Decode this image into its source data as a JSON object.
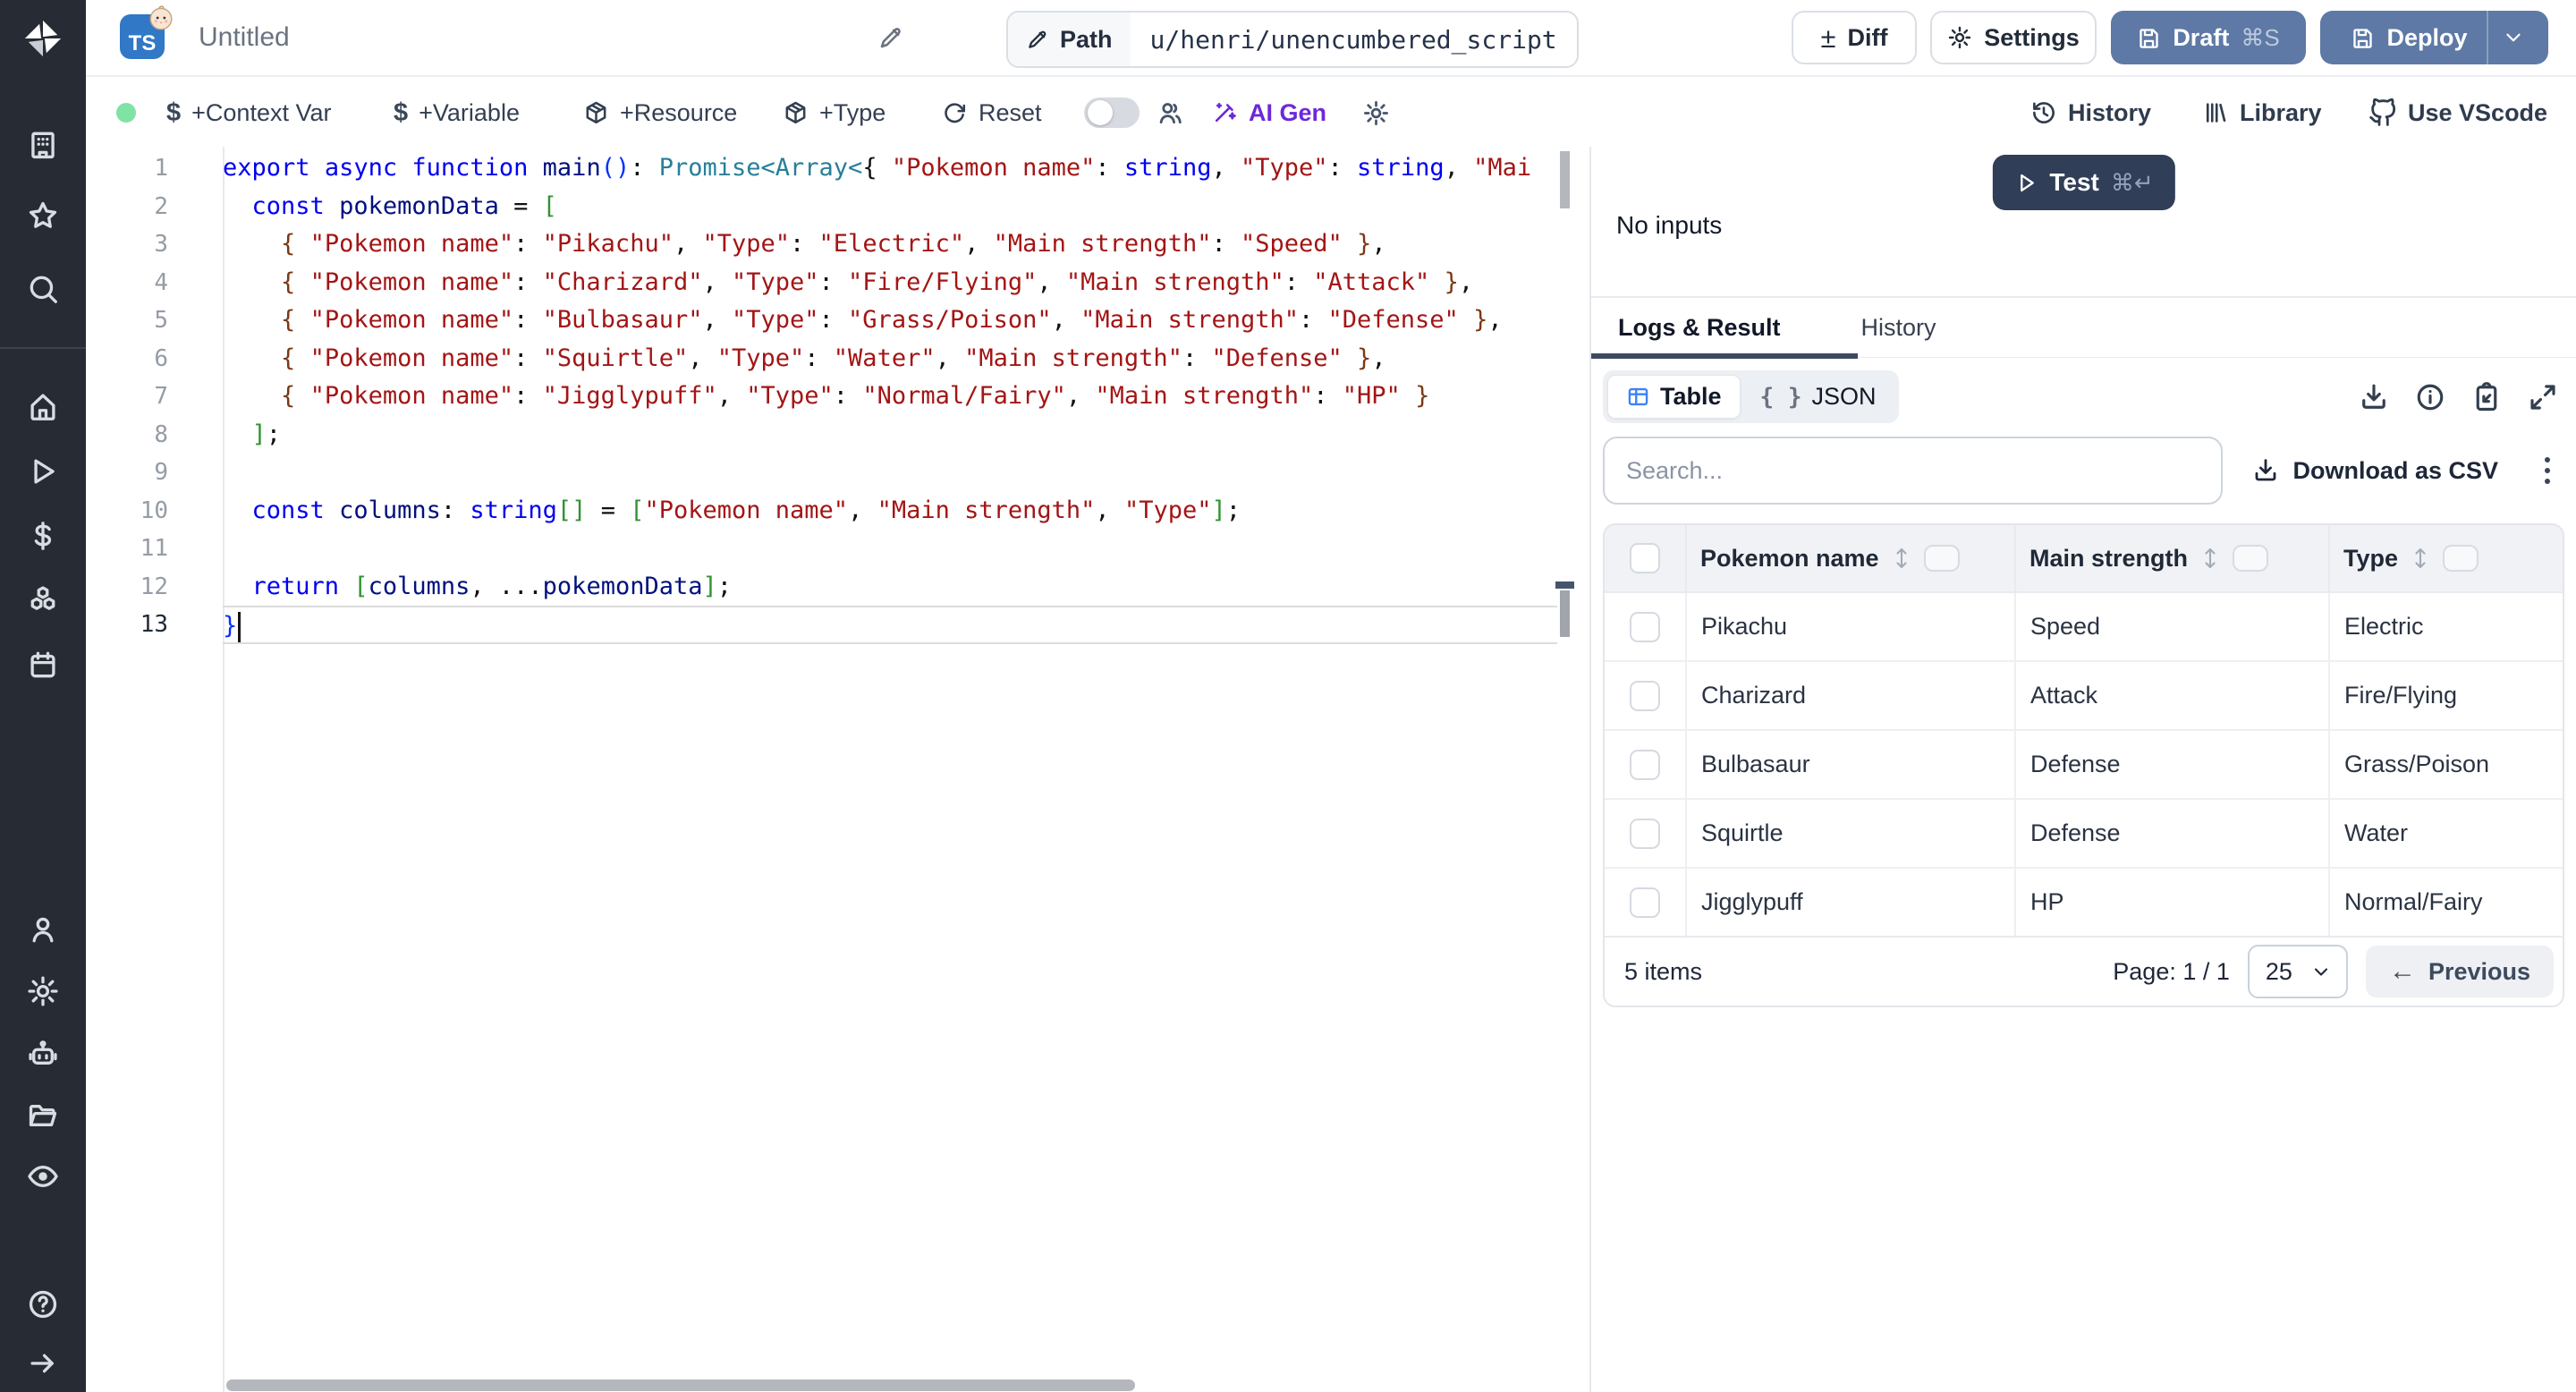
{
  "topbar": {
    "title": "Untitled",
    "path_label": "Path",
    "path_value": "u/henri/unencumbered_script",
    "diff": "Diff",
    "settings": "Settings",
    "draft": "Draft",
    "draft_kbd": "⌘S",
    "deploy": "Deploy",
    "language_badge": "TS"
  },
  "toolbar": {
    "context_var": "+Context Var",
    "variable": "+Variable",
    "resource": "+Resource",
    "type": "+Type",
    "reset": "Reset",
    "ai_gen": "AI Gen",
    "history": "History",
    "library": "Library",
    "vscode": "Use VScode"
  },
  "icons": {
    "dollar": "$",
    "diff_pm": "±",
    "braces": "{ }",
    "prev_arrow": "←"
  },
  "editor": {
    "lines": [
      {
        "num": 1,
        "tokens": [
          [
            "kw",
            "export"
          ],
          [
            "pu",
            " "
          ],
          [
            "kw",
            "async"
          ],
          [
            "pu",
            " "
          ],
          [
            "kw",
            "function"
          ],
          [
            "pu",
            " "
          ],
          [
            "id",
            "main"
          ],
          [
            "b1",
            "()"
          ],
          [
            "pu",
            ": "
          ],
          [
            "ty",
            "Promise<Array<"
          ],
          [
            "pu",
            "{ "
          ],
          [
            "st",
            "\"Pokemon name\""
          ],
          [
            "pu",
            ": "
          ],
          [
            "kw",
            "string"
          ],
          [
            "pu",
            ", "
          ],
          [
            "st",
            "\"Type\""
          ],
          [
            "pu",
            ": "
          ],
          [
            "kw",
            "string"
          ],
          [
            "pu",
            ", "
          ],
          [
            "st",
            "\"Mai"
          ]
        ]
      },
      {
        "num": 2,
        "tokens": [
          [
            "pu",
            "  "
          ],
          [
            "kw",
            "const"
          ],
          [
            "pu",
            " "
          ],
          [
            "id",
            "pokemonData"
          ],
          [
            "pu",
            " = "
          ],
          [
            "b2",
            "["
          ]
        ]
      },
      {
        "num": 3,
        "tokens": [
          [
            "pu",
            "    "
          ],
          [
            "b3",
            "{"
          ],
          [
            "pu",
            " "
          ],
          [
            "st",
            "\"Pokemon name\""
          ],
          [
            "pu",
            ": "
          ],
          [
            "st",
            "\"Pikachu\""
          ],
          [
            "pu",
            ", "
          ],
          [
            "st",
            "\"Type\""
          ],
          [
            "pu",
            ": "
          ],
          [
            "st",
            "\"Electric\""
          ],
          [
            "pu",
            ", "
          ],
          [
            "st",
            "\"Main strength\""
          ],
          [
            "pu",
            ": "
          ],
          [
            "st",
            "\"Speed\""
          ],
          [
            "pu",
            " "
          ],
          [
            "b3",
            "}"
          ],
          [
            "pu",
            ","
          ]
        ]
      },
      {
        "num": 4,
        "tokens": [
          [
            "pu",
            "    "
          ],
          [
            "b3",
            "{"
          ],
          [
            "pu",
            " "
          ],
          [
            "st",
            "\"Pokemon name\""
          ],
          [
            "pu",
            ": "
          ],
          [
            "st",
            "\"Charizard\""
          ],
          [
            "pu",
            ", "
          ],
          [
            "st",
            "\"Type\""
          ],
          [
            "pu",
            ": "
          ],
          [
            "st",
            "\"Fire/Flying\""
          ],
          [
            "pu",
            ", "
          ],
          [
            "st",
            "\"Main strength\""
          ],
          [
            "pu",
            ": "
          ],
          [
            "st",
            "\"Attack\""
          ],
          [
            "pu",
            " "
          ],
          [
            "b3",
            "}"
          ],
          [
            "pu",
            ","
          ]
        ]
      },
      {
        "num": 5,
        "tokens": [
          [
            "pu",
            "    "
          ],
          [
            "b3",
            "{"
          ],
          [
            "pu",
            " "
          ],
          [
            "st",
            "\"Pokemon name\""
          ],
          [
            "pu",
            ": "
          ],
          [
            "st",
            "\"Bulbasaur\""
          ],
          [
            "pu",
            ", "
          ],
          [
            "st",
            "\"Type\""
          ],
          [
            "pu",
            ": "
          ],
          [
            "st",
            "\"Grass/Poison\""
          ],
          [
            "pu",
            ", "
          ],
          [
            "st",
            "\"Main strength\""
          ],
          [
            "pu",
            ": "
          ],
          [
            "st",
            "\"Defense\""
          ],
          [
            "pu",
            " "
          ],
          [
            "b3",
            "}"
          ],
          [
            "pu",
            ","
          ]
        ]
      },
      {
        "num": 6,
        "tokens": [
          [
            "pu",
            "    "
          ],
          [
            "b3",
            "{"
          ],
          [
            "pu",
            " "
          ],
          [
            "st",
            "\"Pokemon name\""
          ],
          [
            "pu",
            ": "
          ],
          [
            "st",
            "\"Squirtle\""
          ],
          [
            "pu",
            ", "
          ],
          [
            "st",
            "\"Type\""
          ],
          [
            "pu",
            ": "
          ],
          [
            "st",
            "\"Water\""
          ],
          [
            "pu",
            ", "
          ],
          [
            "st",
            "\"Main strength\""
          ],
          [
            "pu",
            ": "
          ],
          [
            "st",
            "\"Defense\""
          ],
          [
            "pu",
            " "
          ],
          [
            "b3",
            "}"
          ],
          [
            "pu",
            ","
          ]
        ]
      },
      {
        "num": 7,
        "tokens": [
          [
            "pu",
            "    "
          ],
          [
            "b3",
            "{"
          ],
          [
            "pu",
            " "
          ],
          [
            "st",
            "\"Pokemon name\""
          ],
          [
            "pu",
            ": "
          ],
          [
            "st",
            "\"Jigglypuff\""
          ],
          [
            "pu",
            ", "
          ],
          [
            "st",
            "\"Type\""
          ],
          [
            "pu",
            ": "
          ],
          [
            "st",
            "\"Normal/Fairy\""
          ],
          [
            "pu",
            ", "
          ],
          [
            "st",
            "\"Main strength\""
          ],
          [
            "pu",
            ": "
          ],
          [
            "st",
            "\"HP\""
          ],
          [
            "pu",
            " "
          ],
          [
            "b3",
            "}"
          ]
        ]
      },
      {
        "num": 8,
        "tokens": [
          [
            "pu",
            "  "
          ],
          [
            "b2",
            "]"
          ],
          [
            "pu",
            ";"
          ]
        ]
      },
      {
        "num": 9,
        "tokens": []
      },
      {
        "num": 10,
        "tokens": [
          [
            "pu",
            "  "
          ],
          [
            "kw",
            "const"
          ],
          [
            "pu",
            " "
          ],
          [
            "id",
            "columns"
          ],
          [
            "pu",
            ": "
          ],
          [
            "kw",
            "string"
          ],
          [
            "b2",
            "[]"
          ],
          [
            "pu",
            " = "
          ],
          [
            "b2",
            "["
          ],
          [
            "st",
            "\"Pokemon name\""
          ],
          [
            "pu",
            ", "
          ],
          [
            "st",
            "\"Main strength\""
          ],
          [
            "pu",
            ", "
          ],
          [
            "st",
            "\"Type\""
          ],
          [
            "b2",
            "]"
          ],
          [
            "pu",
            ";"
          ]
        ]
      },
      {
        "num": 11,
        "tokens": []
      },
      {
        "num": 12,
        "tokens": [
          [
            "pu",
            "  "
          ],
          [
            "kw",
            "return"
          ],
          [
            "pu",
            " "
          ],
          [
            "b2",
            "["
          ],
          [
            "id",
            "columns"
          ],
          [
            "pu",
            ", ..."
          ],
          [
            "id",
            "pokemonData"
          ],
          [
            "b2",
            "]"
          ],
          [
            "pu",
            ";"
          ]
        ]
      },
      {
        "num": 13,
        "active": true,
        "cursor": true,
        "tokens": [
          [
            "b1",
            "}"
          ]
        ]
      }
    ]
  },
  "run": {
    "test": "Test",
    "test_kbd": "⌘↵",
    "no_inputs": "No inputs",
    "tabs": [
      "Logs & Result",
      "History"
    ]
  },
  "results": {
    "view_table": "Table",
    "view_json": "JSON",
    "search_placeholder": "Search...",
    "download_csv": "Download as CSV",
    "table": {
      "columns": [
        "Pokemon name",
        "Main strength",
        "Type"
      ],
      "rows": [
        [
          "Pikachu",
          "Speed",
          "Electric"
        ],
        [
          "Charizard",
          "Attack",
          "Fire/Flying"
        ],
        [
          "Bulbasaur",
          "Defense",
          "Grass/Poison"
        ],
        [
          "Squirtle",
          "Defense",
          "Water"
        ],
        [
          "Jigglypuff",
          "HP",
          "Normal/Fairy"
        ]
      ]
    },
    "footer": {
      "items": "5 items",
      "page": "Page: 1 / 1",
      "page_size": "25",
      "previous": "Previous"
    }
  },
  "colors": {
    "accent_slate_blue": "#5e79a5",
    "test_navy": "#313e57",
    "ai_purple": "#6d28d9",
    "status_green": "#7fe3a3",
    "ts_blue": "#3178c6",
    "table_icon_blue": "#3b82f6",
    "sidebar_bg": "#272b33"
  }
}
